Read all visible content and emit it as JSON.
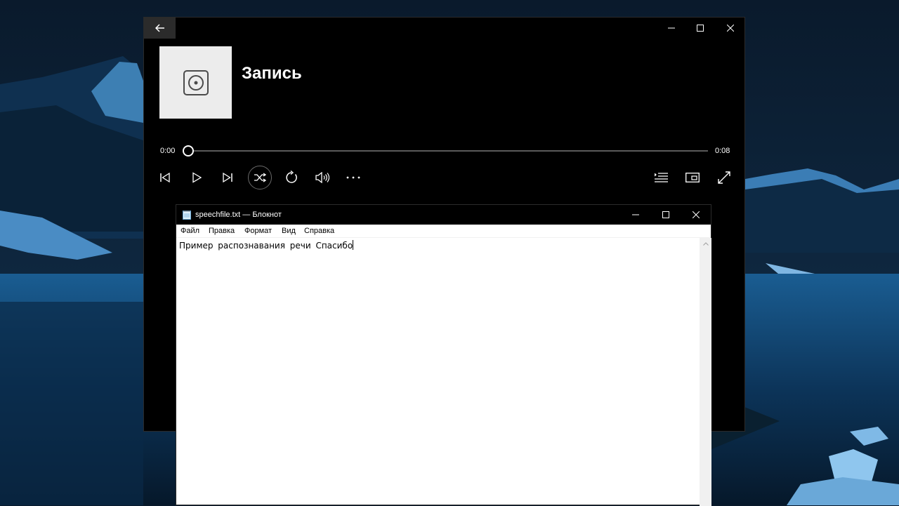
{
  "desktop": {
    "colors": {
      "sky": "#0a1a2c",
      "water": "#0f3a62",
      "snow": "#8fc6ee"
    }
  },
  "media_player": {
    "title": "Запись",
    "position_time": "0:00",
    "duration_time": "0:08",
    "playback_progress": 0,
    "icons": {
      "back": "arrow-left-icon",
      "minimize": "minimize-icon",
      "maximize": "maximize-icon",
      "close": "close-icon",
      "album_art": "disc-icon",
      "previous": "previous-track-icon",
      "play": "play-icon",
      "next": "next-track-icon",
      "shuffle": "shuffle-icon",
      "repeat": "repeat-icon",
      "volume": "volume-icon",
      "more": "more-icon",
      "now_playing_list": "playlist-icon",
      "mini_view": "mini-view-icon",
      "full_screen": "full-screen-icon"
    }
  },
  "notepad": {
    "window_title": "speechfile.txt — Блокнот",
    "menu": [
      "Файл",
      "Правка",
      "Формат",
      "Вид",
      "Справка"
    ],
    "content": "Пример распознавания речи Спасибо"
  }
}
